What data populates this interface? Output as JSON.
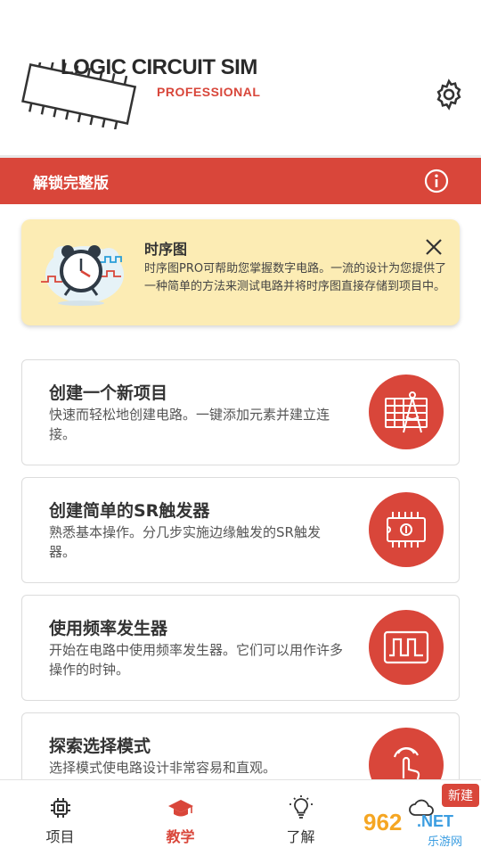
{
  "header": {
    "logo_title": "LOGIC CIRCUIT SIM",
    "logo_subtitle": "PROFESSIONAL",
    "settings_icon": "gear-icon"
  },
  "unlock_banner": {
    "label": "解锁完整版",
    "info_icon": "info-icon"
  },
  "tip": {
    "title": "时序图",
    "text": "时序图PRO可帮助您掌握数字电路。一流的设计为您提供了一种简单的方法来测试电路并将时序图直接存储到项目中。",
    "illustration": "alarm-clock-waveform-illustration",
    "close_icon": "close-icon"
  },
  "cards": [
    {
      "title": "创建一个新项目",
      "desc": "快速而轻松地创建电路。一键添加元素并建立连接。",
      "icon": "drafting-compass-icon"
    },
    {
      "title": "创建简单的SR触发器",
      "desc": "熟悉基本操作。分几步实施边缘触发的SR触发器。",
      "icon": "ic-chip-icon"
    },
    {
      "title": "使用频率发生器",
      "desc": "开始在电路中使用频率发生器。它们可以用作许多操作的时钟。",
      "icon": "square-wave-icon"
    },
    {
      "title": "探索选择模式",
      "desc": "选择模式使电路设计非常容易和直观。",
      "icon": "touch-hand-icon"
    }
  ],
  "nav": {
    "items": [
      {
        "label": "项目",
        "icon": "chip-icon",
        "active": false
      },
      {
        "label": "教学",
        "icon": "graduation-cap-icon",
        "active": true
      },
      {
        "label": "了解",
        "icon": "lightbulb-icon",
        "active": false
      },
      {
        "label": "",
        "icon": "cloud-icon",
        "active": false
      }
    ],
    "new_badge": "新建"
  },
  "watermark": {
    "num": "962",
    "net": ".NET",
    "text": "乐游网"
  },
  "colors": {
    "accent": "#d9463a",
    "tip_bg": "#fcecb4"
  }
}
